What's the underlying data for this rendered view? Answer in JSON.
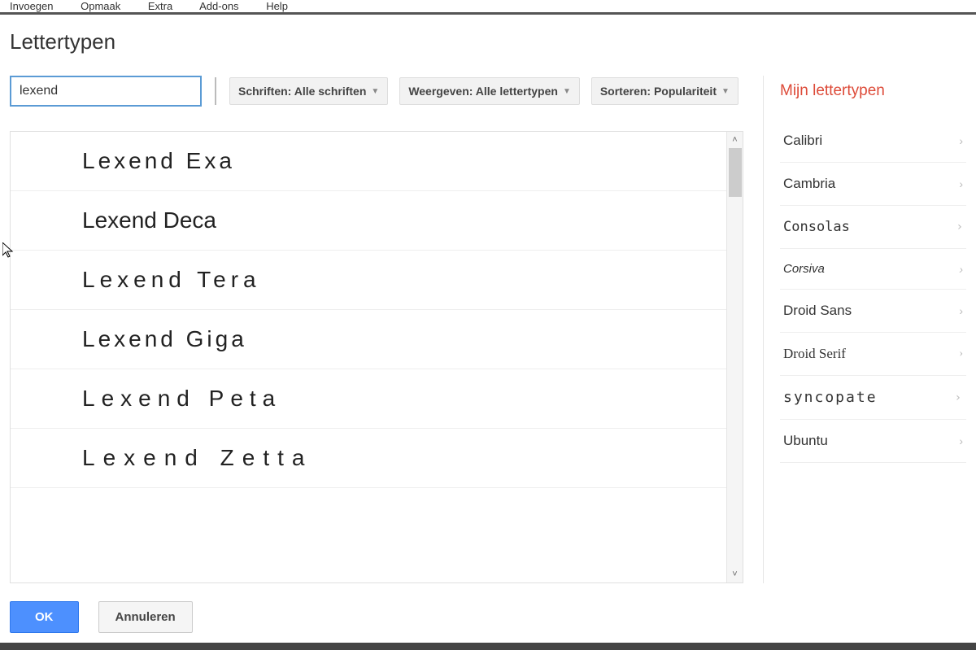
{
  "menubar": {
    "items": [
      "Invoegen",
      "Opmaak",
      "Extra",
      "Add-ons",
      "Help"
    ]
  },
  "dialog": {
    "title": "Lettertypen",
    "search_value": "lexend",
    "filters": {
      "schriften_label": "Schriften: Alle schriften",
      "weergeven_label": "Weergeven: Alle lettertypen",
      "sorteren_label": "Sorteren: Populariteit"
    },
    "font_results": [
      "Lexend Exa",
      "Lexend Deca",
      "Lexend Tera",
      "Lexend Giga",
      "Lexend Peta",
      "Lexend Zetta"
    ],
    "my_fonts_title": "Mijn lettertypen",
    "my_fonts": [
      "Calibri",
      "Cambria",
      "Consolas",
      "Corsiva",
      "Droid Sans",
      "Droid Serif",
      "syncopate",
      "Ubuntu"
    ],
    "ok_label": "OK",
    "cancel_label": "Annuleren"
  }
}
